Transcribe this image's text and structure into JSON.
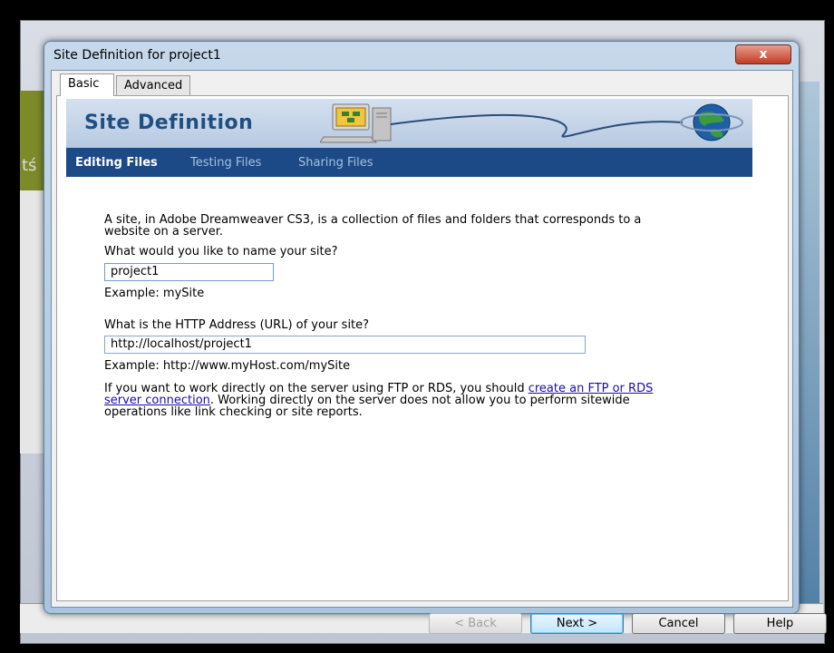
{
  "dialog": {
    "title": "Site Definition for project1",
    "close_label": "x"
  },
  "background": {
    "left_text": "tś"
  },
  "tabs": [
    {
      "label": "Basic",
      "active": true
    },
    {
      "label": "Advanced",
      "active": false
    }
  ],
  "banner": {
    "title": "Site Definition"
  },
  "nav": [
    {
      "label": "Editing Files",
      "active": true
    },
    {
      "label": "Testing Files",
      "active": false
    },
    {
      "label": "Sharing Files",
      "active": false
    }
  ],
  "content": {
    "intro_line1": "A site, in Adobe Dreamweaver CS3, is a collection of files and folders that corresponds to a",
    "intro_line2": "website on a server.",
    "name_question": "What would you like to name your site?",
    "name_value": "project1",
    "name_example": "Example: mySite",
    "url_question": "What is the HTTP Address (URL) of your site?",
    "url_value": "http://localhost/project1",
    "url_example": "Example: http://www.myHost.com/mySite",
    "ftp_text_before": "If you want to work directly on the server using FTP or RDS, you should ",
    "ftp_link_part1": "create an FTP or RDS",
    "ftp_link_part2": "server connection",
    "ftp_text_after": ".  Working directly on the server does not allow you to perform sitewide",
    "ftp_text_line3": "operations like link checking or site reports."
  },
  "buttons": {
    "back": "< Back",
    "next": "Next >",
    "cancel": "Cancel",
    "help": "Help"
  },
  "colors": {
    "nav_bar": "#1c4a86",
    "banner_title": "#1f4f82",
    "link": "#1a0dab"
  }
}
